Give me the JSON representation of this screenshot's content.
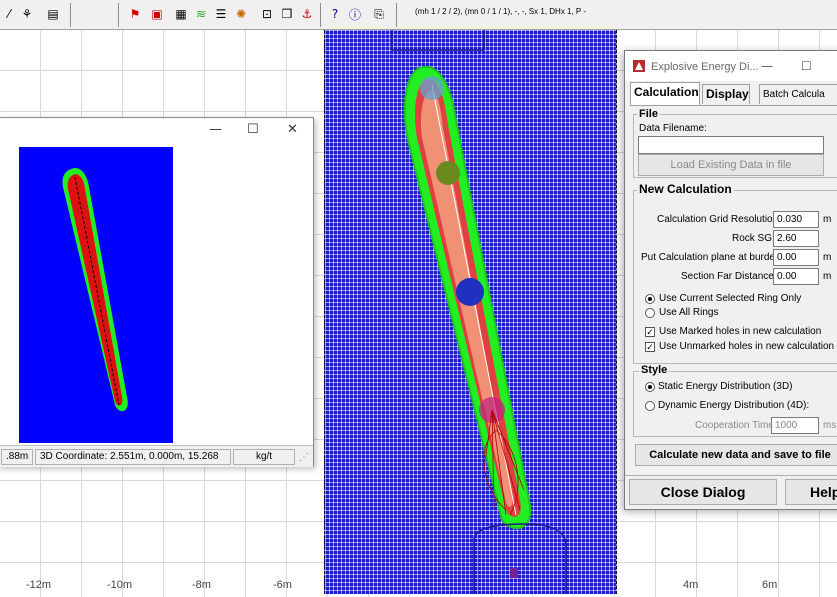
{
  "toolbar": {
    "status": "(mh 1 / 2 / 2), (mn 0 / 1 / 1), -, -, Sx 1, DHx 1, P -"
  },
  "axis": {
    "labels": [
      "-12m",
      "-10m",
      "-8m",
      "-6m",
      "4m",
      "6m"
    ]
  },
  "preview_window": {
    "status_left": ".88m",
    "status_coord": "3D Coordinate: 2.551m, 0.000m, 15.268",
    "status_unit": "kg/t"
  },
  "dialog": {
    "title": "Explosive Energy Di...",
    "tabs": [
      "Calculation",
      "Display",
      "Batch Calcula"
    ],
    "file_group": "File",
    "data_filename_label": "Data Filename:",
    "data_filename_value": "",
    "load_button": "Load Existing Data in file",
    "new_calc_group": "New Calculation",
    "fields": [
      {
        "label": "Calculation Grid Resolution:",
        "value": "0.030",
        "unit": "m"
      },
      {
        "label": "Rock SG:",
        "value": "2.60",
        "unit": ""
      },
      {
        "label": "Put Calculation plane at burden:",
        "value": "0.00",
        "unit": "m"
      },
      {
        "label": "Section Far Distance:",
        "value": "0.00",
        "unit": "m"
      }
    ],
    "ring_options": [
      "Use Current Selected Ring Only",
      "Use All Rings"
    ],
    "hole_options": [
      "Use Marked holes in new calculation",
      "Use Unmarked holes in new calculation"
    ],
    "style_group": "Style",
    "style_options": [
      "Static Energy Distribution (3D)",
      "Dynamic Energy Distribution (4D):"
    ],
    "coop_label": "Cooperation Time:",
    "coop_value": "1000",
    "coop_unit": "ms",
    "calc_button": "Calculate new data and save to file",
    "close_button": "Close Dialog",
    "help_button": "Help"
  },
  "colors": {
    "mesh_blue": "#1a1ad0",
    "contour_green": "#22ee22",
    "contour_red": "#dd1111",
    "preview_bg": "#0000ff"
  }
}
